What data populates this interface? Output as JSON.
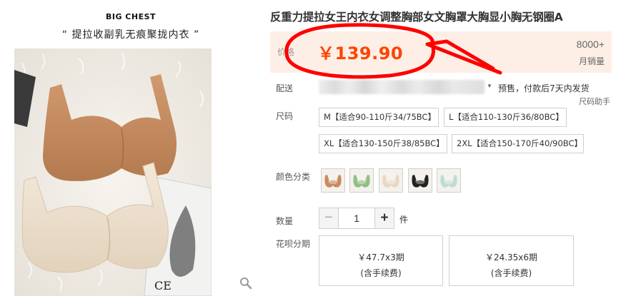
{
  "gallery": {
    "brand": "BIG CHEST",
    "slogan": "“ 提拉收副乳无痕聚拢内衣 ”",
    "photo_text": "CE"
  },
  "product": {
    "title": "反重力提拉女王内衣女调整胸部女文胸罩大胸显小胸无钢圈A"
  },
  "price": {
    "label": "价格",
    "value": "￥139.90",
    "sales_count": "8000+",
    "sales_label": "月销量"
  },
  "shipping": {
    "label": "配送",
    "info": "预售，付款后7天内发货",
    "size_helper": "尺码助手"
  },
  "size": {
    "label": "尺码",
    "options": [
      "M【适合90-110斤34/75BC】",
      "L【适合110-130斤36/80BC】",
      "XL【适合130-150斤38/85BC】",
      "2XL【适合150-170斤40/90BC】"
    ]
  },
  "color": {
    "label": "颜色分类",
    "swatches": [
      {
        "icon": "bra-swatch-icon",
        "accent": "#c98a5c"
      },
      {
        "icon": "bra-swatch-icon",
        "accent": "#8fbf86"
      },
      {
        "icon": "bra-swatch-icon",
        "accent": "#e9d8c4"
      },
      {
        "icon": "bra-swatch-icon",
        "accent": "#222222"
      },
      {
        "icon": "bra-swatch-icon",
        "accent": "#bfdcd4"
      }
    ]
  },
  "quantity": {
    "label": "数量",
    "minus": "−",
    "value": "1",
    "plus": "+",
    "unit": "件"
  },
  "installment": {
    "label": "花呗分期",
    "options": [
      {
        "amount": "￥47.7x3期",
        "note": "(含手续费)"
      },
      {
        "amount": "￥24.35x6期",
        "note": "(含手续费)"
      }
    ]
  },
  "colors": {
    "price": "#ff4400",
    "annotation": "#ff0000",
    "price_bg": "#fdefe6"
  },
  "icons": {
    "zoom": "magnifier-icon",
    "dropdown": "caret-down-icon"
  }
}
